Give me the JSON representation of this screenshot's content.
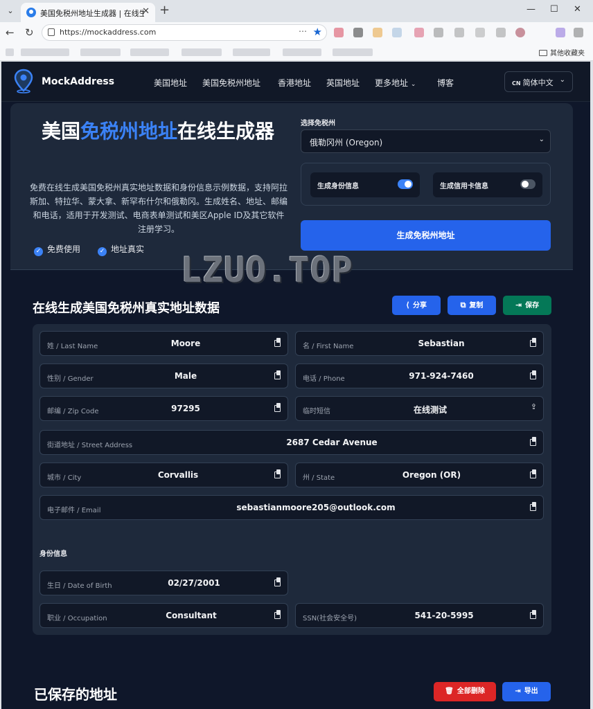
{
  "browser": {
    "tab_title": "美国免税州地址生成器 | 在线生成美国",
    "url": "https://mockaddress.com",
    "other_bookmarks": "其他收藏夹"
  },
  "nav": {
    "logo": "MockAddress",
    "links": [
      "美国地址",
      "美国免税州地址",
      "香港地址",
      "英国地址",
      "更多地址",
      "博客"
    ],
    "lang_code": "CN",
    "lang_label": "简体中文"
  },
  "hero": {
    "title_pre": "美国",
    "title_highlight": "免税州地址",
    "title_post": "在线生成器",
    "description": "免费在线生成美国免税州真实地址数据和身份信息示例数据，支持阿拉斯加、特拉华、蒙大拿、新罕布什尔和俄勒冈。生成姓名、地址、邮编和电话，适用于开发测试、电商表单测试和美区Apple ID及其它软件注册学习。",
    "features": [
      "免费使用",
      "地址真实"
    ]
  },
  "form": {
    "select_label": "选择免税州",
    "selected_state": "俄勒冈州 (Oregon)",
    "toggle_identity_label": "生成身份信息",
    "toggle_identity_on": true,
    "toggle_card_label": "生成信用卡信息",
    "toggle_card_on": false,
    "generate_button": "生成免税州地址"
  },
  "watermark": "LZUO.TOP",
  "result": {
    "title": "在线生成美国免税州真实地址数据",
    "share": "分享",
    "copy": "复制",
    "save": "保存",
    "fields": {
      "last_name": {
        "label": "姓 / Last Name",
        "value": "Moore"
      },
      "first_name": {
        "label": "名 / First Name",
        "value": "Sebastian"
      },
      "gender": {
        "label": "性别 / Gender",
        "value": "Male"
      },
      "phone": {
        "label": "电话 / Phone",
        "value": "971-924-7460"
      },
      "zip": {
        "label": "邮编 / Zip Code",
        "value": "97295"
      },
      "sms": {
        "label": "临时短信",
        "value": "在线测试"
      },
      "street": {
        "label": "街道地址 / Street Address",
        "value": "2687 Cedar Avenue"
      },
      "city": {
        "label": "城市 / City",
        "value": "Corvallis"
      },
      "state": {
        "label": "州 / State",
        "value": "Oregon (OR)"
      },
      "email": {
        "label": "电子邮件 / Email",
        "value": "sebastianmoore205@outlook.com"
      }
    },
    "identity_title": "身份信息",
    "identity": {
      "dob": {
        "label": "生日 / Date of Birth",
        "value": "02/27/2001"
      },
      "occupation": {
        "label": "职业 / Occupation",
        "value": "Consultant"
      },
      "ssn": {
        "label": "SSN(社会安全号)",
        "value": "541-20-5995"
      }
    }
  },
  "saved": {
    "title": "已保存的地址",
    "clear_all": "全部删除",
    "export": "导出"
  }
}
